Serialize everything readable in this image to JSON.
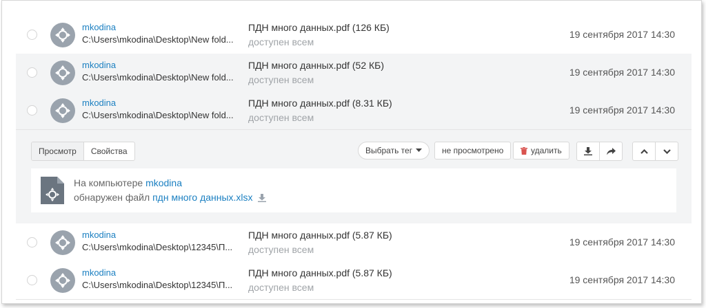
{
  "rows_top": [
    {
      "user": "mkodina",
      "path": "C:\\Users\\mkodina\\Desktop\\New fold...",
      "file": "ПДН много данных.pdf (126 КБ)",
      "access": "доступен всем",
      "date": "19 сентября 2017 14:30"
    },
    {
      "user": "mkodina",
      "path": "C:\\Users\\mkodina\\Desktop\\New fold...",
      "file": "ПДН много данных.pdf (52 КБ)",
      "access": "доступен всем",
      "date": "19 сентября 2017 14:30"
    },
    {
      "user": "mkodina",
      "path": "C:\\Users\\mkodina\\Desktop\\New fold...",
      "file": "ПДН много данных.pdf (8.31 КБ)",
      "access": "доступен всем",
      "date": "19 сентября 2017 14:30"
    }
  ],
  "detail": {
    "tabs": [
      "Просмотр",
      "Свойства"
    ],
    "tag_select": "Выбрать тег",
    "not_viewed": "не просмотрено",
    "delete": "удалить",
    "info_prefix": "На компьютере",
    "info_user": "mkodina",
    "found_prefix": "обнаружен файл",
    "found_file": "пдн много данных.xlsx"
  },
  "rows_bottom": [
    {
      "user": "mkodina",
      "path": "C:\\Users\\mkodina\\Desktop\\12345\\П...",
      "file": "ПДН много данных.pdf (5.87 КБ)",
      "access": "доступен всем",
      "date": "19 сентября 2017 14:30"
    },
    {
      "user": "mkodina",
      "path": "C:\\Users\\mkodina\\Desktop\\12345\\П...",
      "file": "ПДН много данных.pdf (5.87 КБ)",
      "access": "доступен всем",
      "date": "19 сентября 2017 14:30"
    }
  ],
  "icons": {
    "avatar": "crosshair-icon",
    "file": "document-crosshair-icon",
    "delete": "trash-icon",
    "download": "download-icon",
    "share": "share-arrow-icon",
    "up": "chevron-up-icon",
    "down": "chevron-down-icon",
    "caret": "caret-down-icon"
  },
  "colors": {
    "link": "#1a7fc1",
    "muted": "#a0a4a8",
    "highlight_bg": "#f3f4f5",
    "avatar_bg": "#9aa3ad",
    "delete_red": "#d9534f"
  }
}
